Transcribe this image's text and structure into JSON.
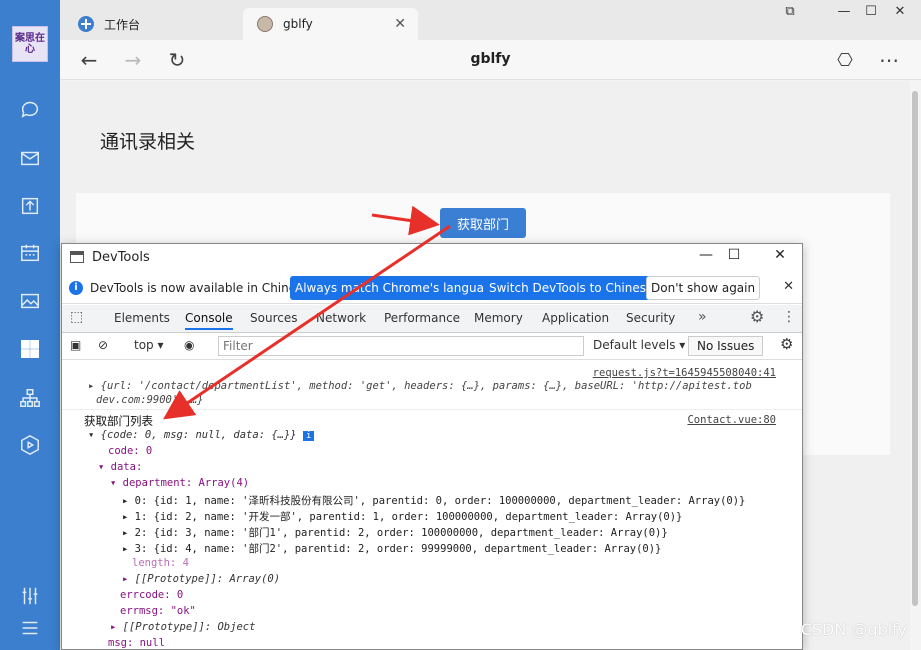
{
  "sidebar": {
    "logo_text": "案思在心",
    "icons": [
      "chat-icon",
      "mail-icon",
      "upload-icon",
      "calendar-icon",
      "gallery-icon",
      "apps-icon",
      "org-chart-icon",
      "play-icon",
      "sliders-icon",
      "menu-icon"
    ]
  },
  "browser": {
    "tabs": [
      {
        "label": "工作台"
      },
      {
        "label": "gblfy"
      }
    ],
    "page_title": "gblfy"
  },
  "page": {
    "heading": "通讯录相关",
    "button_label": "获取部门"
  },
  "devtools": {
    "title": "DevTools",
    "info_message": "DevTools is now available in Chinese!",
    "btn_match_language": "Always match Chrome's language",
    "btn_switch_chinese": "Switch DevTools to Chinese",
    "btn_dont_show": "Don't show again",
    "tabs": [
      "Elements",
      "Console",
      "Sources",
      "Network",
      "Performance",
      "Memory",
      "Application",
      "Security"
    ],
    "active_tab": "Console",
    "context": "top",
    "filter_placeholder": "Filter",
    "levels": "Default levels",
    "issues": "No Issues",
    "console": {
      "src1": "request.js?t=1645945508040:41",
      "line1_a": "{url: '/contact/departmentList', method: 'get', headers: {…}, params: {…}, baseURL: 'http://apitest.tob",
      "line1_b": "dev.com:9900', …}",
      "log_label": "获取部门列表",
      "src2": "Contact.vue:80",
      "obj_summary": "{code: 0, msg: null, data: {…}}",
      "code_line": "code: 0",
      "data_line": "data:",
      "department_line": "department: Array(4)",
      "items": [
        "0: {id: 1, name: '泽昕科技股份有限公司', parentid: 0, order: 100000000, department_leader: Array(0)}",
        "1: {id: 2, name: '开发一部', parentid: 1, order: 100000000, department_leader: Array(0)}",
        "2: {id: 3, name: '部门1', parentid: 2, order: 100000000, department_leader: Array(0)}",
        "3: {id: 4, name: '部门2', parentid: 2, order: 99999000, department_leader: Array(0)}"
      ],
      "length_line": "length: 4",
      "proto_array": "[[Prototype]]: Array(0)",
      "errcode_line": "errcode: 0",
      "errmsg_line": "errmsg: \"ok\"",
      "proto_object": "[[Prototype]]: Object",
      "msg_line": "msg: null"
    }
  },
  "watermark": "CSDN @gblfy",
  "colors": {
    "sidebar": "#3b7fce",
    "primary_button": "#3a7fd4",
    "annotation_arrow": "#e8302a"
  }
}
